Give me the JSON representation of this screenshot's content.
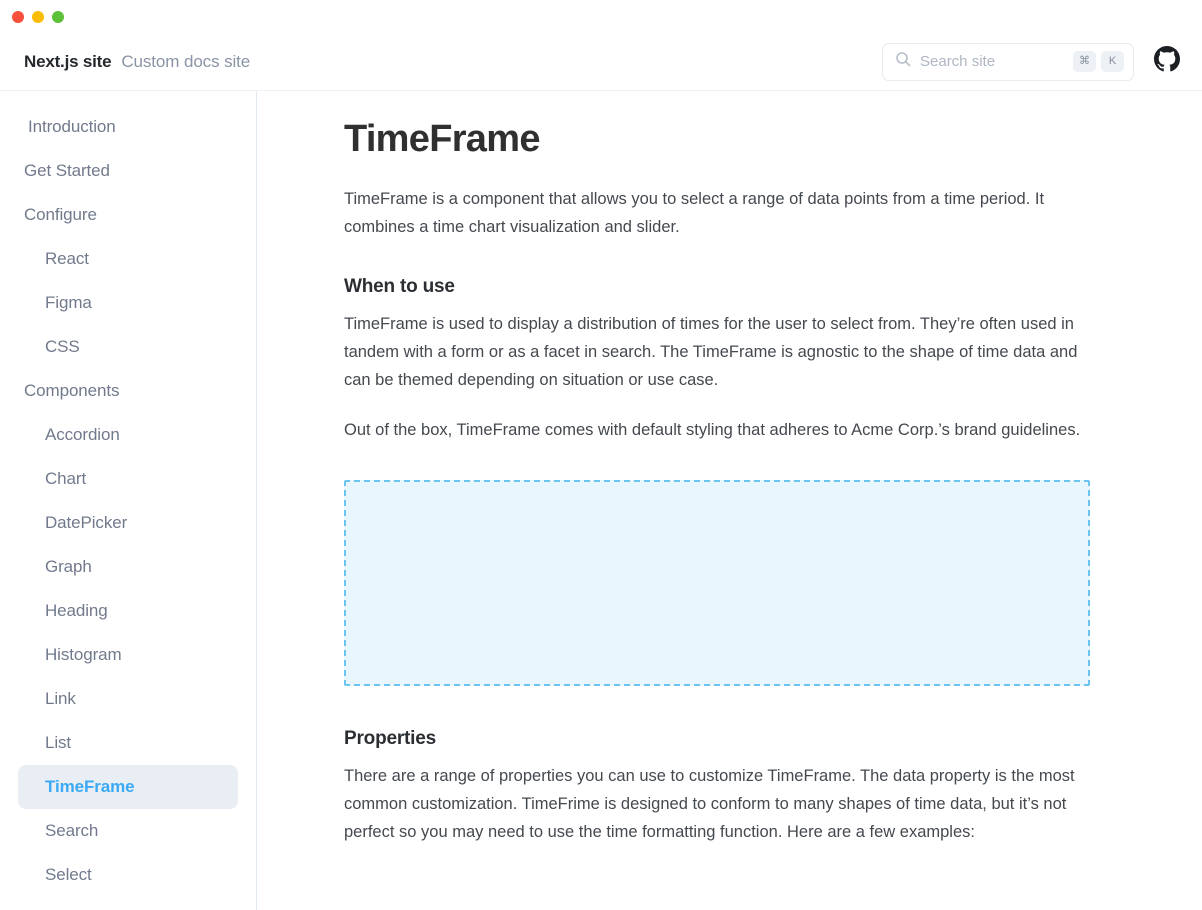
{
  "window": {
    "traffic_lights": [
      {
        "name": "close",
        "color": "#F8503C"
      },
      {
        "name": "minimize",
        "color": "#FBBC05"
      },
      {
        "name": "maximize",
        "color": "#5CC039"
      }
    ]
  },
  "header": {
    "brand_name": "Next.js site",
    "brand_subtitle": "Custom docs site",
    "search": {
      "placeholder": "Search site",
      "value": "",
      "icon": "search-icon",
      "shortcut_keys": [
        "⌘",
        "K"
      ]
    },
    "github": {
      "icon": "github-icon",
      "label": "GitHub"
    }
  },
  "sidebar": {
    "items": [
      {
        "label": "Introduction",
        "level": 0,
        "indented": true,
        "active": false
      },
      {
        "label": "Get Started",
        "level": 0,
        "indented": false,
        "active": false
      },
      {
        "label": "Configure",
        "level": 0,
        "indented": false,
        "active": false
      },
      {
        "label": "React",
        "level": 1,
        "indented": false,
        "active": false
      },
      {
        "label": "Figma",
        "level": 1,
        "indented": false,
        "active": false
      },
      {
        "label": "CSS",
        "level": 1,
        "indented": false,
        "active": false
      },
      {
        "label": "Components",
        "level": 0,
        "indented": false,
        "active": false
      },
      {
        "label": "Accordion",
        "level": 1,
        "indented": false,
        "active": false
      },
      {
        "label": "Chart",
        "level": 1,
        "indented": false,
        "active": false
      },
      {
        "label": "DatePicker",
        "level": 1,
        "indented": false,
        "active": false
      },
      {
        "label": "Graph",
        "level": 1,
        "indented": false,
        "active": false
      },
      {
        "label": "Heading",
        "level": 1,
        "indented": false,
        "active": false
      },
      {
        "label": "Histogram",
        "level": 1,
        "indented": false,
        "active": false
      },
      {
        "label": "Link",
        "level": 1,
        "indented": false,
        "active": false
      },
      {
        "label": "List",
        "level": 1,
        "indented": false,
        "active": false
      },
      {
        "label": "TimeFrame",
        "level": 1,
        "indented": false,
        "active": true
      },
      {
        "label": "Search",
        "level": 1,
        "indented": false,
        "active": false
      },
      {
        "label": "Select",
        "level": 1,
        "indented": false,
        "active": false
      }
    ],
    "active_color": "#3BA9F5",
    "active_background": "#E8EEF4"
  },
  "main": {
    "title": "TimeFrame",
    "intro": "TimeFrame is a component that allows you to select a range of data points from a time period. It combines a time chart visualization and slider.",
    "when_to_use": {
      "heading": "When to use",
      "paragraph1": "TimeFrame is used to display a distribution of times for the user to select from. They’re often used in tandem with a form or as a facet in search. The TimeFrame is agnostic to the shape of time data and can be themed depending on situation or use case.",
      "paragraph2": "Out of the box, TimeFrame comes with default styling that adheres to Acme Corp.’s brand guidelines."
    },
    "component_preview": {
      "name": "component-preview-placeholder",
      "fill": "#EAF6FD",
      "border": "#6CC4F0"
    },
    "properties": {
      "heading": "Properties",
      "paragraph1": "There are a range of properties you can use to customize TimeFrame. The data property is the most common customization. TimeFrime is designed to conform to many shapes of time data, but it’s not perfect so you may need to use the time formatting function. Here are a few examples:"
    }
  }
}
